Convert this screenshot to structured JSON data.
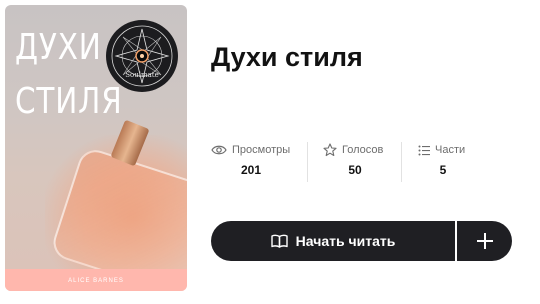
{
  "book": {
    "title": "Духи стиля",
    "cover": {
      "title_line1": "ДУХИ",
      "title_line2": "СТИЛЯ",
      "badge_label": "Soulmate",
      "author_strip": "ALICE BARNES",
      "strip_color": "#ffb7ad"
    }
  },
  "stats": [
    {
      "icon": "eye-icon",
      "label": "Просмотры",
      "value": "201"
    },
    {
      "icon": "star-icon",
      "label": "Голосов",
      "value": "50"
    },
    {
      "icon": "list-icon",
      "label": "Части",
      "value": "5"
    }
  ],
  "actions": {
    "read_label": "Начать читать",
    "read_icon": "book-icon",
    "add_icon": "plus-icon",
    "button_color": "#1f1f23"
  }
}
